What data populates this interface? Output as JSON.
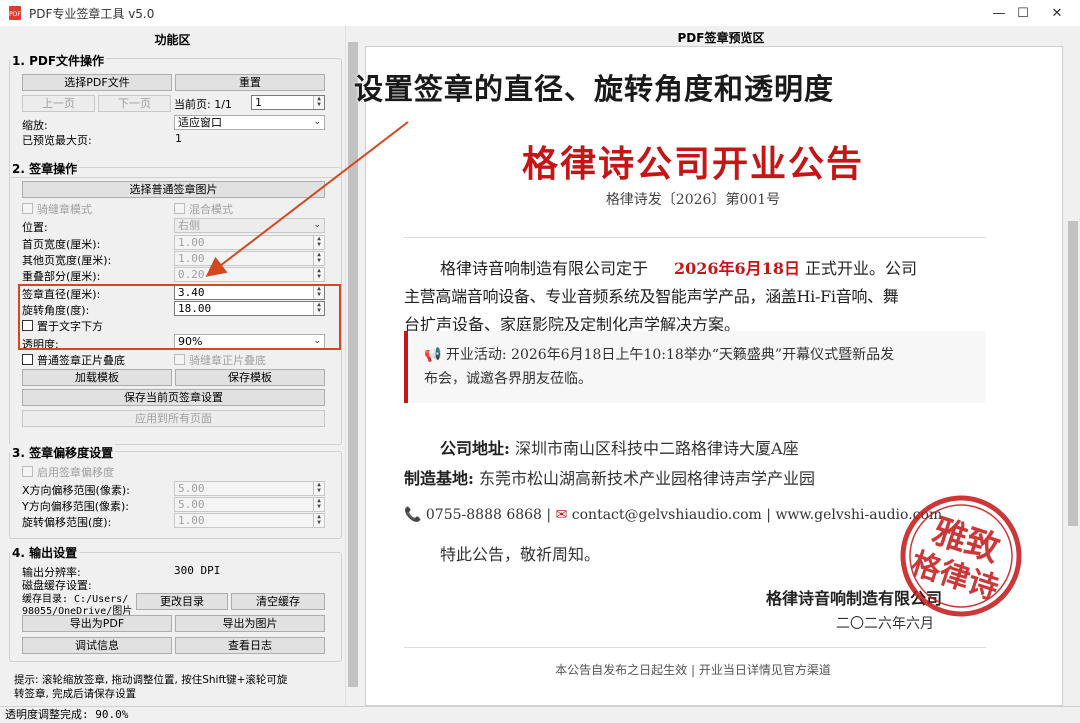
{
  "window": {
    "title": "PDF专业签章工具 v5.0",
    "controls": {
      "minimize": "—",
      "maximize": "☐",
      "close": "✕"
    }
  },
  "left_panel": {
    "title": "功能区",
    "pdf_ops": {
      "title": "1. PDF文件操作",
      "select_pdf": "选择PDF文件",
      "reset": "重置",
      "prev_page": "上一页",
      "next_page": "下一页",
      "current_page_label": "当前页: 1/1",
      "current_page_value": "1",
      "zoom_label": "缩放:",
      "zoom_value": "适应窗口",
      "max_preview_label": "已预览最大页:",
      "max_preview_value": "1"
    },
    "sign_ops": {
      "title": "2. 签章操作",
      "select_image": "选择普通签章图片",
      "seam_mode": "骑缝章模式",
      "mixed_mode": "混合模式",
      "position_label": "位置:",
      "position_value": "右侧",
      "first_width_label": "首页宽度(厘米):",
      "first_width_value": "1.00",
      "other_width_label": "其他页宽度(厘米):",
      "other_width_value": "1.00",
      "overlap_label": "重叠部分(厘米):",
      "overlap_value": "0.20",
      "diameter_label": "签章直径(厘米):",
      "diameter_value": "3.40",
      "rotation_label": "旋转角度(度):",
      "rotation_value": "18.00",
      "below_text": "置于文字下方",
      "opacity_label": "透明度:",
      "opacity_value": "90%",
      "normal_overlay": "普通签章正片叠底",
      "seam_overlay": "骑缝章正片叠底",
      "load_template": "加载模板",
      "save_template": "保存模板",
      "save_current": "保存当前页签章设置",
      "apply_all": "应用到所有页面"
    },
    "offset": {
      "title": "3. 签章偏移度设置",
      "enable": "启用签章偏移度",
      "x_label": "X方向偏移范围(像素):",
      "x_value": "5.00",
      "y_label": "Y方向偏移范围(像素):",
      "y_value": "5.00",
      "rot_label": "旋转偏移范围(度):",
      "rot_value": "1.00"
    },
    "output": {
      "title": "4. 输出设置",
      "resolution_label": "输出分辨率:",
      "resolution_value": "300 DPI",
      "cache_label": "磁盘缓存设置:",
      "cache_dir_line1": "缓存目录: C:/Users/",
      "cache_dir_line2": "98055/OneDrive/图片",
      "change_dir": "更改目录",
      "clear_cache": "清空缓存",
      "export_pdf": "导出为PDF",
      "export_image": "导出为图片",
      "debug": "调试信息",
      "view_log": "查看日志"
    },
    "hint_line1": "提示: 滚轮缩放签章, 拖动调整位置, 按住Shift键+滚轮可旋",
    "hint_line2": "转签章, 完成后请保存设置"
  },
  "status_bar": "透明度调整完成: 90.0%",
  "preview": {
    "title": "PDF签章预览区",
    "doc_title": "格律诗公司开业公告",
    "doc_number": "格律诗发〔2026〕第001号",
    "para_1a": "格律诗音响制造有限公司定于",
    "para_1_date": "2026年6月18日",
    "para_1b": "正式开业。公司",
    "para_2": "主营高端音响设备、专业音频系统及智能声学产品，涵盖Hi-Fi音响、舞",
    "para_3": "台扩声设备、家庭影院及定制化声学解决方案。",
    "activity_line1": "开业活动: 2026年6月18日上午10:18举办“天籁盛典”开幕仪式暨新品发",
    "activity_line2": "布会，诚邀各界朋友莅临。",
    "address_label": "公司地址:",
    "address_value": "深圳市南山区科技中二路格律诗大厦A座",
    "factory_label": "制造基地:",
    "factory_value": "东莞市松山湖高新技术产业园格律诗声学产业园",
    "phone": "0755-8888 6868",
    "email": "contact@gelvshiaudio.com",
    "website": "www.gelvshi-audio.com",
    "closing": "特此公告，敬祈周知。",
    "company": "格律诗音响制造有限公司",
    "date": "二〇二六年六月",
    "footer": "本公告自发布之日起生效 | 开业当日详情见官方渠道",
    "seal_text": "雅致格律诗"
  },
  "annotation": "设置签章的直径、旋转角度和透明度",
  "colors": {
    "accent_red": "#c41616",
    "highlight": "#d4481f"
  }
}
